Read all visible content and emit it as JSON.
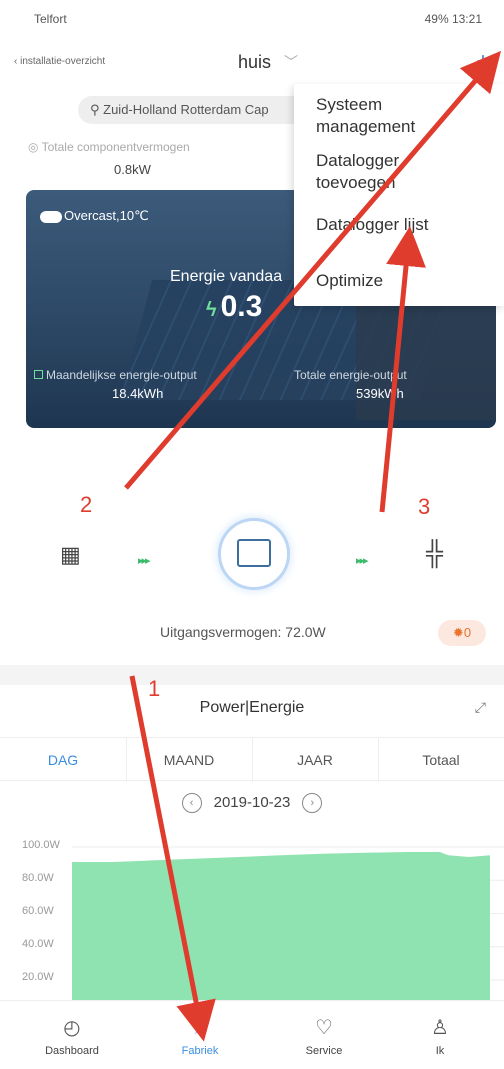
{
  "status": {
    "carrier": "Telfort",
    "right": "49%  13:21"
  },
  "header": {
    "back_label": "installatie-overzicht",
    "title": "huis",
    "add_icon": "plus-icon"
  },
  "location": {
    "text": "Zuid-Holland Rotterdam Cap"
  },
  "capacity": {
    "label": "Totale componentvermogen",
    "value": "0.8kW"
  },
  "card": {
    "weather": "Overcast,10℃",
    "energy_today_label": "Energie vandaa",
    "energy_today_value": "0.3",
    "monthly_label": "Maandelijkse energie-output",
    "monthly_value": "18.4kWh",
    "total_label": "Totale energie-output",
    "total_value": "539kWh"
  },
  "menu": {
    "items": [
      "Systeem management",
      "Datalogger toevoegen",
      "Datalogger lijst",
      "Optimize"
    ]
  },
  "flow": {
    "output_label": "Uitgangsvermogen: 72.0W",
    "alarm_count": "0"
  },
  "power": {
    "title": "Power|Energie",
    "tabs": [
      "DAG",
      "MAAND",
      "JAAR",
      "Totaal"
    ],
    "active_tab": "DAG",
    "date": "2019-10-23"
  },
  "chart_data": {
    "type": "area",
    "yticks": [
      "100.0W",
      "80.0W",
      "60.0W",
      "40.0W",
      "20.0W"
    ],
    "ylim": [
      20,
      100
    ],
    "x": [
      0,
      0.1,
      0.2,
      0.3,
      0.4,
      0.5,
      0.6,
      0.7,
      0.8,
      0.85,
      0.88,
      0.9,
      0.95,
      1
    ],
    "values": [
      91,
      91,
      92,
      93,
      94,
      95,
      96,
      96.5,
      97,
      97,
      97,
      95,
      94,
      95
    ],
    "color": "#8fe3b0"
  },
  "bottom_nav": [
    {
      "label": "Dashboard",
      "icon": "dashboard-icon"
    },
    {
      "label": "Fabriek",
      "icon": "plant-icon"
    },
    {
      "label": "Service",
      "icon": "heart-icon"
    },
    {
      "label": "Ik",
      "icon": "person-icon"
    }
  ],
  "annotations": [
    "1",
    "2",
    "3"
  ],
  "accent": "#3c8ee0",
  "arrow_color": "#e03c2e"
}
